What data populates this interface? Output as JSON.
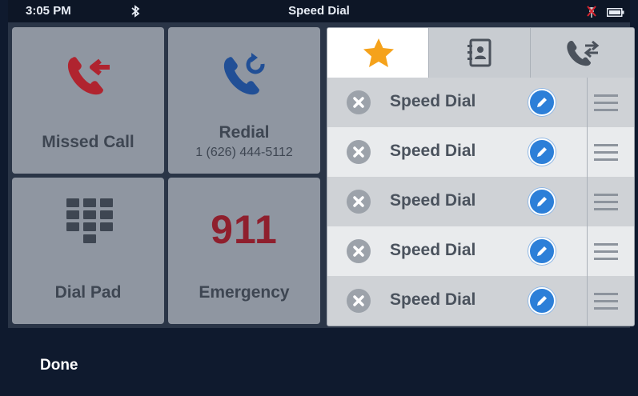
{
  "status": {
    "time": "3:05 PM",
    "title": "Speed Dial"
  },
  "tiles": {
    "missed": {
      "label": "Missed Call"
    },
    "redial": {
      "label": "Redial",
      "number": "1 (626) 444-5112"
    },
    "dialpad": {
      "label": "Dial Pad"
    },
    "emergency": {
      "number": "911",
      "label": "Emergency"
    }
  },
  "tabs": [
    {
      "icon": "star-icon"
    },
    {
      "icon": "contacts-icon"
    },
    {
      "icon": "call-transfer-icon"
    }
  ],
  "speed_dial_rows": [
    {
      "label": "Speed Dial"
    },
    {
      "label": "Speed Dial"
    },
    {
      "label": "Speed Dial"
    },
    {
      "label": "Speed Dial"
    },
    {
      "label": "Speed Dial"
    }
  ],
  "footer": {
    "done": "Done"
  },
  "colors": {
    "accent_blue": "#2c7fd8",
    "missed_red": "#b0242f",
    "star": "#f5a21b"
  }
}
